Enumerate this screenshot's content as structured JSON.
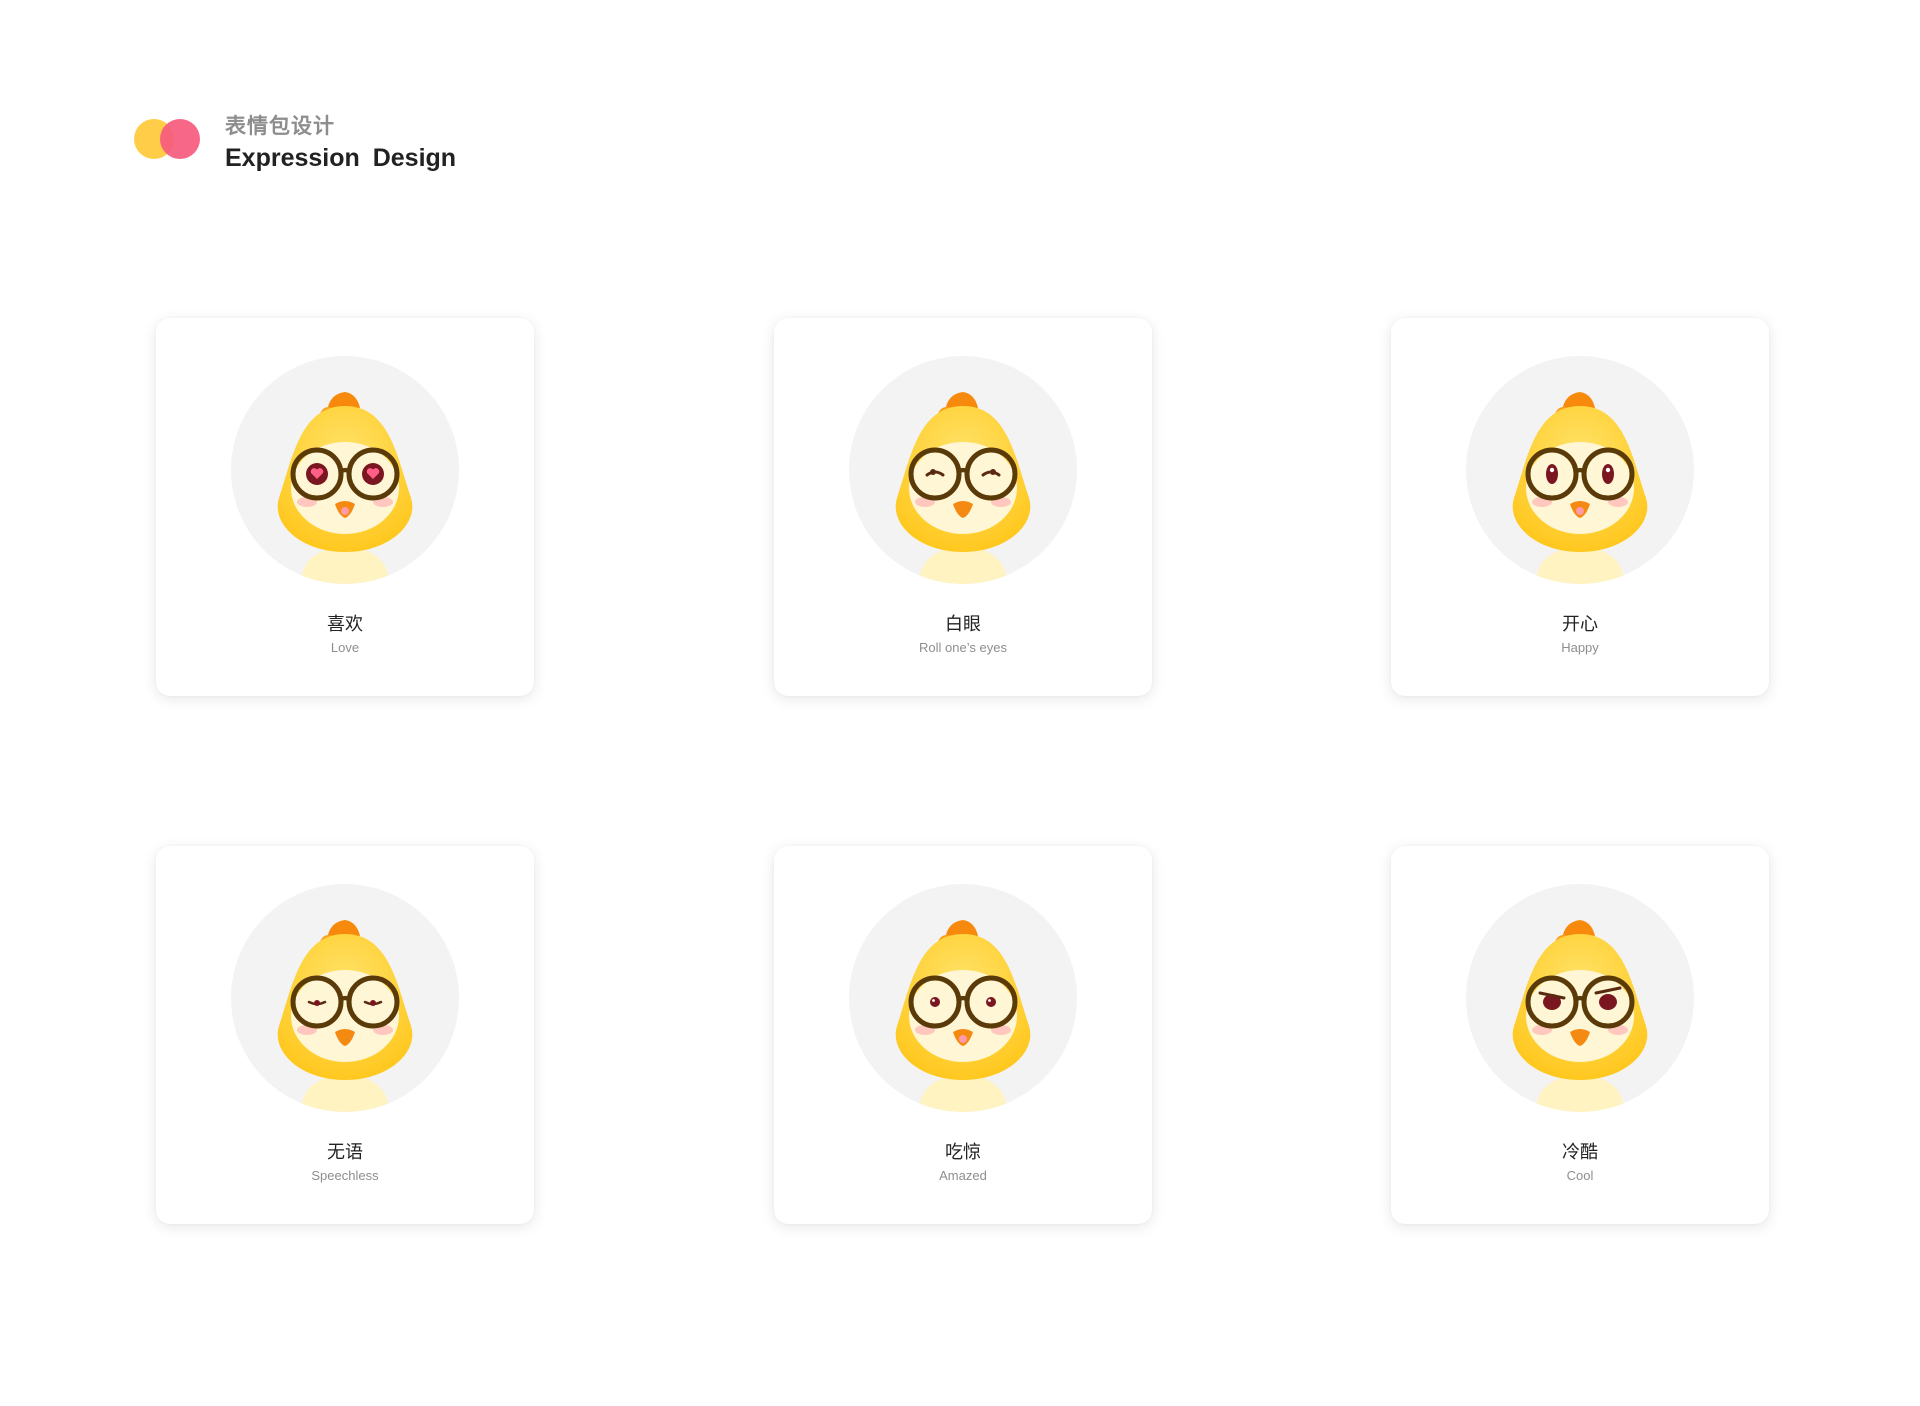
{
  "header": {
    "title_cn": "表情包设计",
    "title_en": "Expression  Design",
    "logo_colors": [
      "#ffcd47",
      "#f65b7e"
    ]
  },
  "expressions": [
    {
      "label_cn": "喜欢",
      "label_en": "Love",
      "eyes": "hearts"
    },
    {
      "label_cn": "白眼",
      "label_en": "Roll one’s eyes",
      "eyes": "rolled"
    },
    {
      "label_cn": "开心",
      "label_en": "Happy",
      "eyes": "happy"
    },
    {
      "label_cn": "无语",
      "label_en": "Speechless",
      "eyes": "flat"
    },
    {
      "label_cn": "吃惊",
      "label_en": "Amazed",
      "eyes": "dots"
    },
    {
      "label_cn": "冷酷",
      "label_en": "Cool",
      "eyes": "cool"
    }
  ],
  "colors": {
    "card_bg": "#ffffff",
    "avatar_bg": "#f3f3f3",
    "chick_yellow": "#ffc61a",
    "chick_face": "#fff6d6",
    "comb_orange": "#f7890c",
    "glasses": "#5a3a08"
  }
}
